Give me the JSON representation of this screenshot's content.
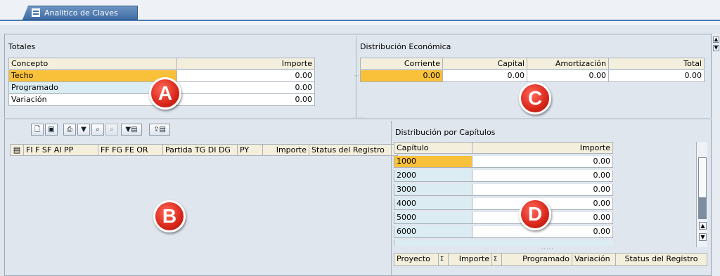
{
  "tab": {
    "label": "Analitico de Claves"
  },
  "totales": {
    "title": "Totales",
    "headers": [
      "Concepto",
      "Importe"
    ],
    "rows": [
      {
        "concepto": "Techo",
        "importe": "0.00"
      },
      {
        "concepto": "Programado",
        "importe": "0.00"
      },
      {
        "concepto": "Variación",
        "importe": "0.00"
      }
    ]
  },
  "distribucion_economica": {
    "title": "Distribución Económica",
    "headers": [
      "Corriente",
      "Capital",
      "Amortización",
      "Total"
    ],
    "row": [
      "0.00",
      "0.00",
      "0.00",
      "0.00"
    ]
  },
  "toolbar": {
    "icons": [
      "new-document-icon",
      "save-local-icon",
      "print-icon",
      "filter-icon",
      "find-icon",
      "find-next-icon",
      "filter-menu-icon",
      "export-menu-icon"
    ],
    "glyphs": [
      "🗋",
      "▣",
      "⎙",
      "▼",
      "⌕",
      "⌕",
      "▼▤",
      "⇪▤"
    ]
  },
  "claves_grid": {
    "headers": [
      "FI F SF AI PP",
      "FF FG FE OR",
      "Partida TG DI DG",
      "PY",
      "Importe",
      "Status del Registro"
    ]
  },
  "distribucion_capitulos": {
    "title": "Distribución por Capítulos",
    "headers": [
      "Capítulo",
      "Importe"
    ],
    "rows": [
      {
        "capitulo": "1000",
        "importe": "0.00"
      },
      {
        "capitulo": "2000",
        "importe": "0.00"
      },
      {
        "capitulo": "3000",
        "importe": "0.00"
      },
      {
        "capitulo": "4000",
        "importe": "0.00"
      },
      {
        "capitulo": "5000",
        "importe": "0.00"
      },
      {
        "capitulo": "6000",
        "importe": "0.00"
      }
    ]
  },
  "proyecto_grid": {
    "headers": [
      "Proyecto",
      "Importe",
      "Programado",
      "Variación",
      "Status del Registro"
    ],
    "sum_marker": "Σ"
  },
  "markers": {
    "a": "A",
    "b": "B",
    "c": "C",
    "d": "D"
  },
  "colors": {
    "selected": "#f9c03a",
    "row_tint": "#dcecf3",
    "header": "#f3efdc",
    "marker": "#d8261a",
    "tab": "#3f6ea6"
  }
}
